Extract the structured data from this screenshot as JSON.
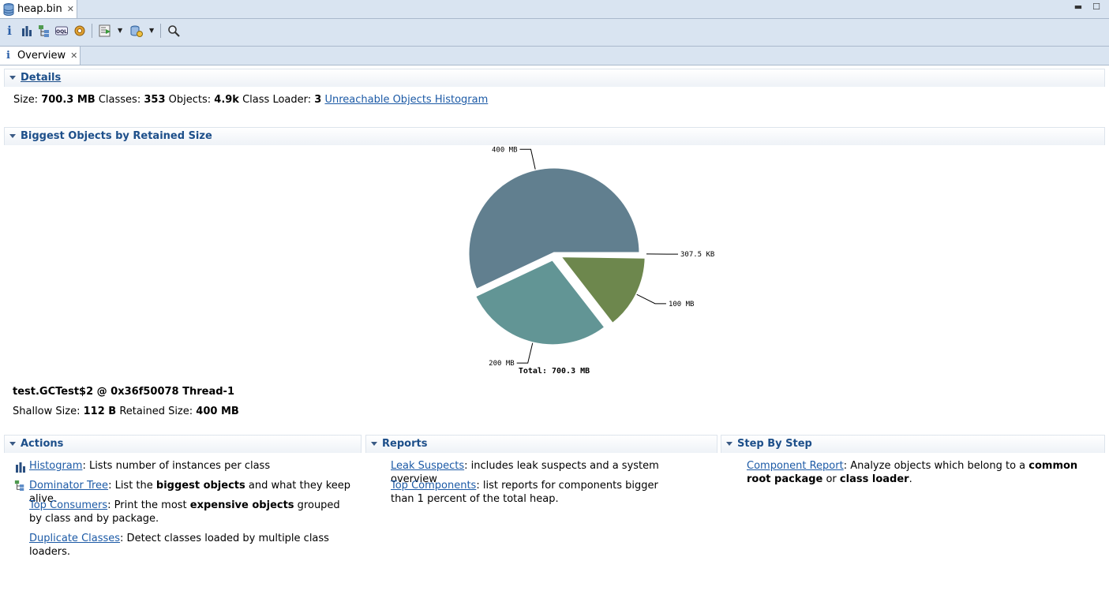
{
  "editor": {
    "tab_title": "heap.bin"
  },
  "subtab": {
    "label": "Overview"
  },
  "details": {
    "title": "Details",
    "size_label": "Size:",
    "size_value": "700.3 MB",
    "classes_label": "Classes:",
    "classes_value": "353",
    "objects_label": "Objects:",
    "objects_value": "4.9k",
    "loader_label": "Class Loader:",
    "loader_value": "3",
    "unreachable_link": "Unreachable Objects Histogram"
  },
  "biggest": {
    "title": "Biggest Objects by Retained Size",
    "selected_object": "test.GCTest$2 @ 0x36f50078 Thread-1",
    "shallow_label": "Shallow Size:",
    "shallow_value": "112 B",
    "retained_label": "Retained Size:",
    "retained_value": "400 MB"
  },
  "chart_data": {
    "type": "pie",
    "slices": [
      {
        "label": "400 MB",
        "value": 400,
        "color": "#617f8f"
      },
      {
        "label": "200 MB",
        "value": 200,
        "color": "#629595"
      },
      {
        "label": "100 MB",
        "value": 100,
        "color": "#6d874d"
      },
      {
        "label": "307.5 KB",
        "value": 0.3003,
        "color": "#6d874d"
      }
    ],
    "total_label": "Total: 700.3 MB"
  },
  "actions": {
    "title": "Actions",
    "items": [
      {
        "link": "Histogram",
        "pre": ": Lists number of instances per class",
        "bold": "",
        "post": ""
      },
      {
        "link": "Dominator Tree",
        "pre": ": List the ",
        "bold": "biggest objects",
        "post": " and what they keep alive."
      },
      {
        "link": "Top Consumers",
        "pre": ": Print the most ",
        "bold": "expensive objects",
        "post": " grouped by class and by package."
      },
      {
        "link": "Duplicate Classes",
        "pre": ": Detect classes loaded by multiple class loaders.",
        "bold": "",
        "post": ""
      }
    ]
  },
  "reports": {
    "title": "Reports",
    "items": [
      {
        "link": "Leak Suspects",
        "text": ": includes leak suspects and a system overview"
      },
      {
        "link": "Top Components",
        "text": ": list reports for components bigger than 1 percent of the total heap."
      }
    ]
  },
  "stepbystep": {
    "title": "Step By Step",
    "link": "Component Report",
    "pre": ": Analyze objects which belong to a ",
    "bold1": "common root package",
    "mid": " or ",
    "bold2": "class loader",
    "post": "."
  }
}
